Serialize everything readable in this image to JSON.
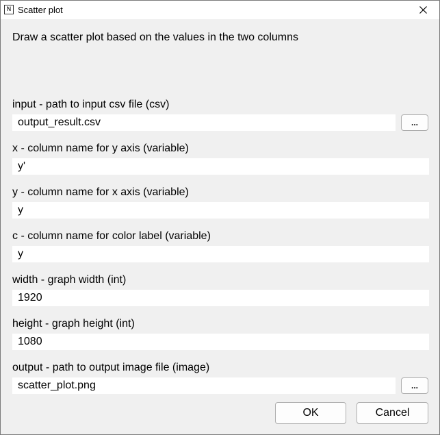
{
  "window": {
    "title": "Scatter plot",
    "icon_letter": "N"
  },
  "description": "Draw a scatter plot based on the values in the two columns",
  "fields": [
    {
      "label": "input - path to input csv file (csv)",
      "value": "output_result.csv",
      "has_browse": true
    },
    {
      "label": "x - column name for y axis (variable)",
      "value": "y'",
      "has_browse": false
    },
    {
      "label": "y - column name for x axis (variable)",
      "value": "y",
      "has_browse": false
    },
    {
      "label": "c - column name for color label (variable)",
      "value": "y",
      "has_browse": false
    },
    {
      "label": "width - graph width (int)",
      "value": "1920",
      "has_browse": false
    },
    {
      "label": "height - graph height (int)",
      "value": "1080",
      "has_browse": false
    },
    {
      "label": "output - path to output image file (image)",
      "value": "scatter_plot.png",
      "has_browse": true
    }
  ],
  "browse_label": "...",
  "buttons": {
    "ok": "OK",
    "cancel": "Cancel"
  },
  "icons": {
    "close": "close-icon",
    "app": "app-icon"
  }
}
